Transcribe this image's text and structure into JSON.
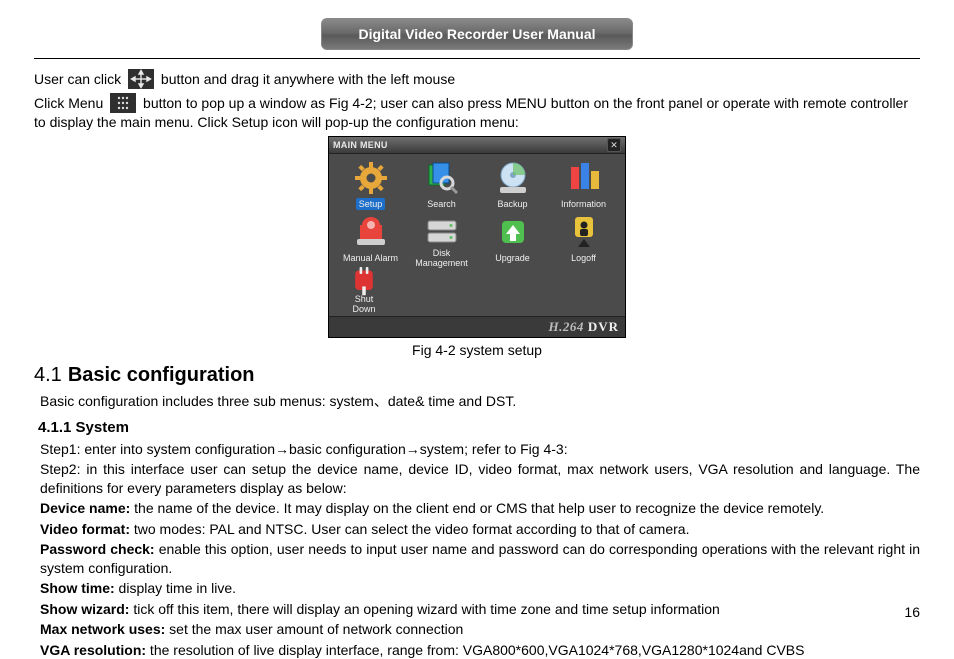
{
  "header": {
    "title": "Digital Video Recorder User Manual"
  },
  "intro_lines": {
    "l1_a": "User can click ",
    "l1_b": " button and drag it anywhere with the left mouse",
    "l2_a": "Click Menu ",
    "l2_b": "button to pop up a window as Fig 4-2; user can also press MENU button on the front panel or operate with remote controller to display the main menu. Click Setup icon will pop-up the configuration menu:"
  },
  "figure": {
    "title": "MAIN MENU",
    "items_row1": [
      {
        "label": "Setup",
        "selected": true,
        "icon": "gear"
      },
      {
        "label": "Search",
        "selected": false,
        "icon": "search"
      },
      {
        "label": "Backup",
        "selected": false,
        "icon": "backup"
      },
      {
        "label": "Information",
        "selected": false,
        "icon": "info"
      }
    ],
    "items_row2": [
      {
        "label": "Manual Alarm",
        "selected": false,
        "icon": "alarm"
      },
      {
        "label": "Disk Management",
        "selected": false,
        "icon": "disk"
      },
      {
        "label": "Upgrade",
        "selected": false,
        "icon": "upgrade"
      },
      {
        "label": "Logoff",
        "selected": false,
        "icon": "logoff"
      }
    ],
    "items_row3": [
      {
        "label": "Shut Down",
        "selected": false,
        "icon": "power"
      }
    ],
    "footer_brand_h264": "H.264",
    "footer_brand_dvr": "DVR",
    "caption": "Fig 4-2 system setup"
  },
  "section": {
    "number": "4.1",
    "title": "Basic configuration",
    "intro": "Basic configuration includes three sub menus: system、date& time and DST.",
    "sub_number": "4.1.1",
    "sub_title": "System",
    "step1": "Step1: enter into system configuration→basic configuration→system; refer to Fig 4-3:",
    "step2": "Step2: in this interface user can setup the device name, device ID, video format, max network users, VGA resolution and language. The definitions for every parameters display as below:",
    "definitions": [
      {
        "term": "Device name:",
        "desc": " the name of the device. It may display on the client end or CMS that help user to recognize the device remotely."
      },
      {
        "term": "Video format:",
        "desc": " two modes: PAL and NTSC. User can select the video format according to that of camera."
      },
      {
        "term": "Password check:",
        "desc": " enable this option, user needs to input user name and password can do corresponding operations with the relevant right in system configuration."
      },
      {
        "term": "Show time:",
        "desc": " display time in live."
      },
      {
        "term": "Show wizard:",
        "desc": " tick off this item, there will display an opening wizard with time zone and time setup information"
      },
      {
        "term": "Max network uses:",
        "desc": " set the max user amount of network connection"
      },
      {
        "term": "VGA resolution:",
        "desc": " the resolution of live display interface, range from: VGA800*600,VGA1024*768,VGA1280*1024and CVBS"
      }
    ]
  },
  "page_number": "16"
}
